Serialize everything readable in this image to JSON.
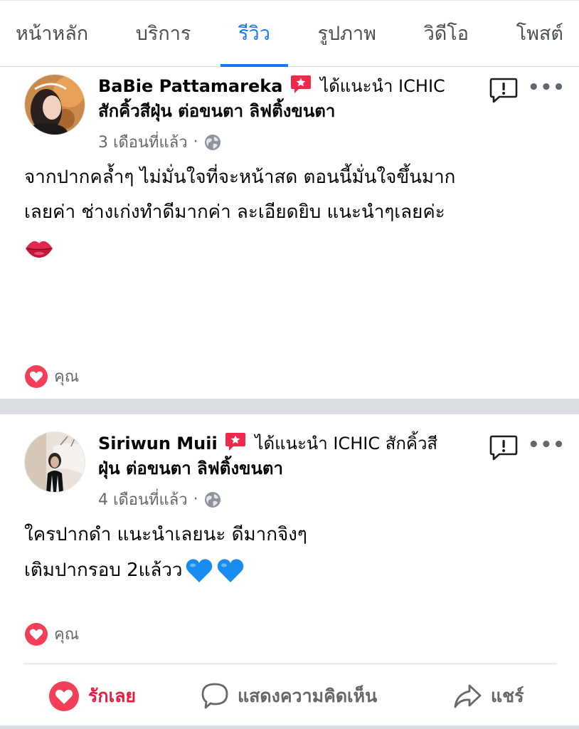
{
  "tabs": [
    "หน้าหลัก",
    "บริการ",
    "รีวิว",
    "รูปภาพ",
    "วิดีโอ",
    "โพสต์"
  ],
  "active_tab": "รีวิว",
  "posts": [
    {
      "author": "BaBie Pattamareka",
      "recommend_line1": "ได้แนะนำ ICHIC",
      "recommend_line2": "สักคิ้วสีฝุ่น ต่อขนตา ลิฟติ้งขนตา",
      "time": "3 เดือนที่แล้ว",
      "text_lines": [
        "จากปากคล้ำๆ ไม่มั่นใจที่จะหน้าสด ตอนนี้มั่นใจขึ้นมาก",
        "เลยค่า ช่างเก่งทำดีมากค่า ละเอียดยิบ แนะนำๆเลยค่ะ"
      ],
      "reactor": "คุณ"
    },
    {
      "author": "Siriwun Muii",
      "recommend_line1": "ได้แนะนำ ICHIC สักคิ้วสี",
      "recommend_line2": "ฝุ่น ต่อขนตา ลิฟติ้งขนตา",
      "time": "4 เดือนที่แล้ว",
      "text_lines": [
        "ใครปากดำ แนะนำเลยนะ ดีมากจิงๆ",
        "เติมปากรอบ 2แล้วว"
      ],
      "reactor": "คุณ"
    }
  ],
  "actions": {
    "love": "รักเลย",
    "comment": "แสดงความคิดเห็น",
    "share": "แชร์"
  },
  "separator_dot": "·",
  "colors": {
    "accent": "#1877f2",
    "love_red": "#e41e3f",
    "secondary_text": "#65676b",
    "separator": "#dadde1"
  },
  "icons": [
    "recommend-icon",
    "globe-icon",
    "report-icon",
    "more-icon",
    "heart-icon",
    "comment-icon",
    "share-icon",
    "lips-emoji",
    "blue-heart-emoji"
  ]
}
